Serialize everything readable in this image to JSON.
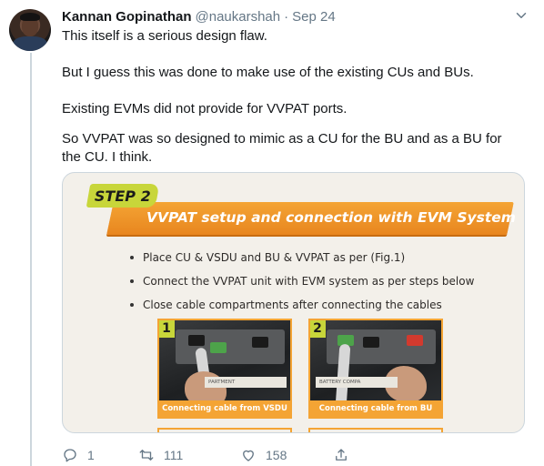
{
  "tweet": {
    "author_name": "Kannan Gopinathan",
    "handle": "@naukarshah",
    "separator": "·",
    "date": "Sep 24",
    "paragraphs": [
      "This itself is a serious design flaw.",
      "But I guess this was done to make use of the existing CUs and BUs.",
      "Existing EVMs did not provide for VVPAT ports.",
      "So VVPAT was so designed to mimic as a CU for the BU and as a BU for the CU. I think."
    ]
  },
  "media": {
    "step_label": "STEP 2",
    "banner_title": "VVPAT setup and connection with EVM System",
    "bullets": [
      "Place CU & VSDU and BU & VVPAT as per (Fig.1)",
      "Connect the VVPAT unit with EVM system as per steps below",
      "Close cable compartments after connecting the cables"
    ],
    "photos": [
      {
        "number": "1",
        "caption": "Connecting cable from VSDU",
        "plate_text": "PARTMENT"
      },
      {
        "number": "2",
        "caption": "Connecting cable from BU",
        "plate_text": "BATTERY COMPA"
      }
    ]
  },
  "actions": {
    "reply_count": "1",
    "retweet_count": "111",
    "like_count": "158"
  },
  "icons": {
    "more": "chevron-down-icon",
    "reply": "reply-icon",
    "retweet": "retweet-icon",
    "like": "heart-icon",
    "share": "share-icon"
  },
  "colors": {
    "text_primary": "#14171a",
    "text_secondary": "#657786",
    "border": "#ccd6dd",
    "banner_orange": "#f4a434",
    "step_green": "#c8d63a"
  }
}
